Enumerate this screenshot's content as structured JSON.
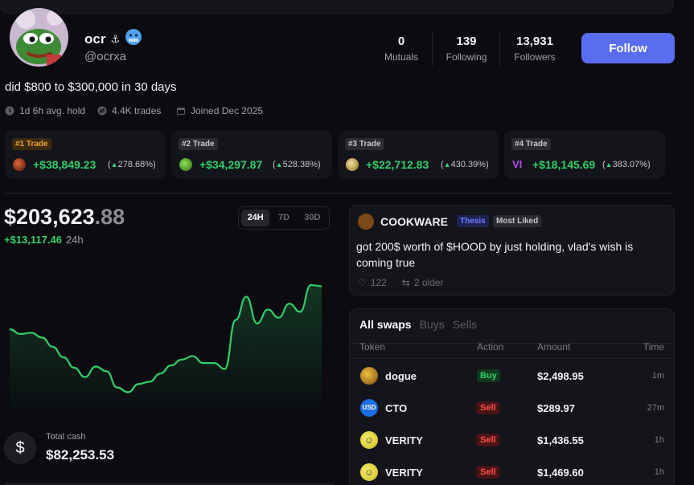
{
  "profile": {
    "name": "ocr",
    "handle": "@ocrxa",
    "bio": "did $800 to $300,000 in 30 days",
    "avg_hold": "1d 6h avg. hold",
    "trades": "4.4K trades",
    "joined": "Joined Dec 2025"
  },
  "stats": {
    "mutuals_num": "0",
    "mutuals_label": "Mutuals",
    "following_num": "139",
    "following_label": "Following",
    "followers_num": "13,931",
    "followers_label": "Followers"
  },
  "follow_label": "Follow",
  "top_trades": [
    {
      "tag": "#1 Trade",
      "pnl": "+$38,849.23",
      "pct": "278.68%",
      "token_icon": "dark-red-coin-icon"
    },
    {
      "tag": "#2 Trade",
      "pnl": "+$34,297.87",
      "pct": "528.38%",
      "token_icon": "green-frog-icon"
    },
    {
      "tag": "#3 Trade",
      "pnl": "+$22,712.83",
      "pct": "430.39%",
      "token_icon": "gold-coin-icon"
    },
    {
      "tag": "#4 Trade",
      "pnl": "+$18,145.69",
      "pct": "383.07%",
      "token_icon": "purple-vi-icon"
    }
  ],
  "portfolio": {
    "value_main": "$203,623",
    "value_cents": ".88",
    "change": "+$13,117.46",
    "period": "24h",
    "timeframes": [
      "24H",
      "7D",
      "30D"
    ],
    "active_timeframe": "24H"
  },
  "chart_data": {
    "type": "line",
    "series": [
      {
        "values": [
          62,
          58,
          59,
          55,
          47,
          38,
          29,
          21,
          30,
          26,
          12,
          8,
          15,
          17,
          24,
          31,
          36,
          39,
          33,
          33,
          28,
          70,
          90,
          67,
          79,
          72,
          84,
          77,
          100,
          99
        ]
      }
    ],
    "colors": {
      "line": "#2fd06a"
    }
  },
  "cash": {
    "label": "Total cash",
    "value": "$82,253.53"
  },
  "post": {
    "author": "COOKWARE",
    "badge1": "Thesis",
    "badge2": "Most Liked",
    "text": "got 200$ worth of $HOOD by just holding, vlad's wish is coming true",
    "likes": "122",
    "older": "2 older"
  },
  "swaps": {
    "tabs": [
      "All swaps",
      "Buys",
      "Sells"
    ],
    "headers": {
      "token": "Token",
      "action": "Action",
      "amount": "Amount",
      "time": "Time"
    },
    "rows": [
      {
        "token": "dogue",
        "action": "Buy",
        "amount": "$2,498.95",
        "time": "1m"
      },
      {
        "token": "CTO",
        "action": "Sell",
        "amount": "$289.97",
        "time": "27m"
      },
      {
        "token": "VERITY",
        "action": "Sell",
        "amount": "$1,436.55",
        "time": "1h"
      },
      {
        "token": "VERITY",
        "action": "Sell",
        "amount": "$1,469.60",
        "time": "1h"
      }
    ]
  },
  "colors": {
    "accent": "#5a6df0",
    "positive": "#2fd06a",
    "negative": "#ff4d4d"
  }
}
